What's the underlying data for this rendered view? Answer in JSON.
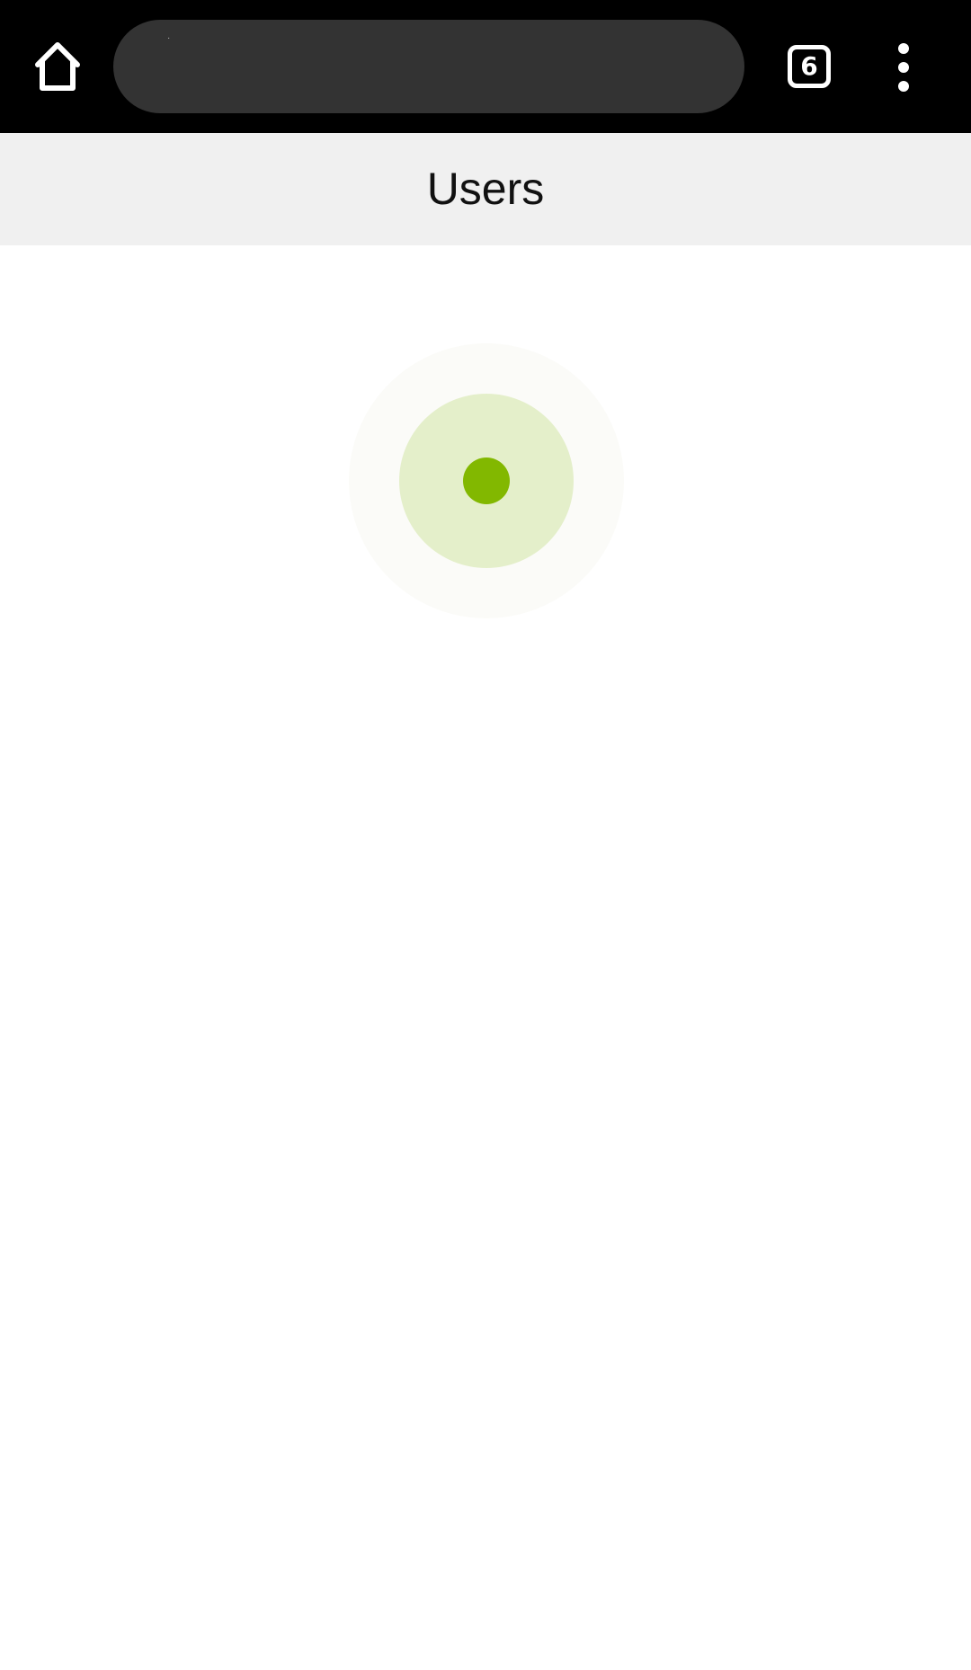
{
  "browser": {
    "url_text": "·",
    "tab_count": "6",
    "icons": {
      "home": "home-icon",
      "tabs": "tab-switcher-icon",
      "menu": "more-vert-icon"
    }
  },
  "page": {
    "title": "Users"
  },
  "loading": {
    "state": "loading",
    "accent_color": "#82b800"
  }
}
